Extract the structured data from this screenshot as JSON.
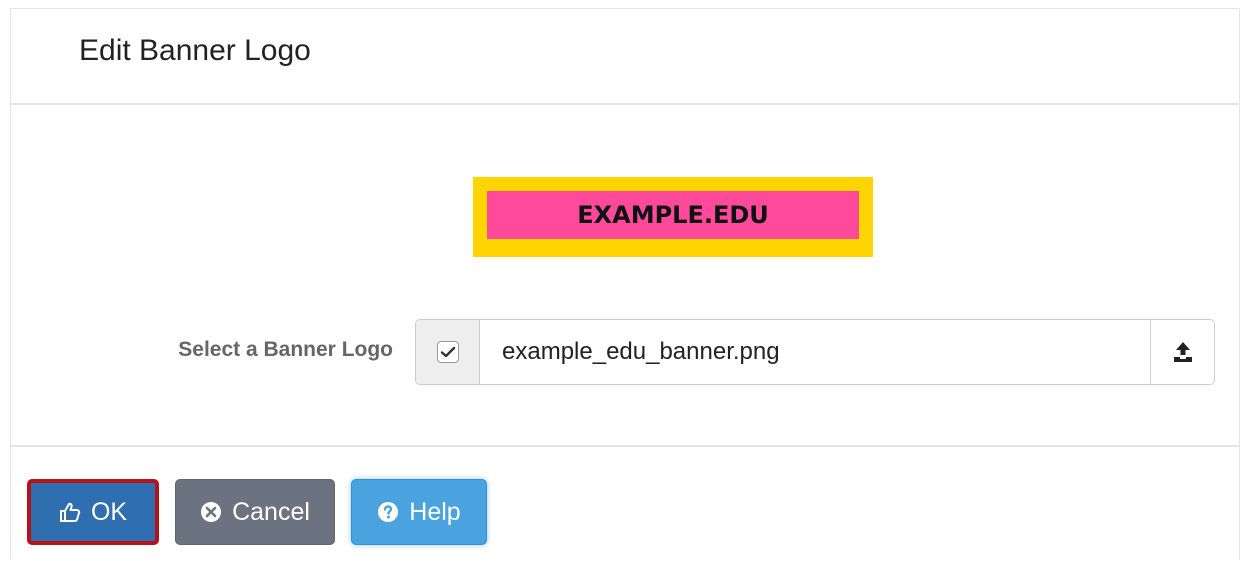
{
  "dialog": {
    "title": "Edit Banner Logo"
  },
  "banner": {
    "text": "EXAMPLE.EDU",
    "outer_color": "#ffd500",
    "inner_color": "#ff4a9b"
  },
  "field": {
    "label": "Select a Banner Logo",
    "checked": true,
    "file_name": "example_edu_banner.png",
    "check_icon": "check-icon",
    "upload_icon": "upload-icon"
  },
  "buttons": {
    "ok_label": "OK",
    "ok_icon": "thumbs-up-icon",
    "cancel_label": "Cancel",
    "cancel_icon": "times-circle-icon",
    "help_label": "Help",
    "help_icon": "question-circle-icon"
  },
  "colors": {
    "primary": "#2f6fb0",
    "secondary": "#6b7280",
    "info": "#4aa3df",
    "highlight": "#b5121b"
  }
}
